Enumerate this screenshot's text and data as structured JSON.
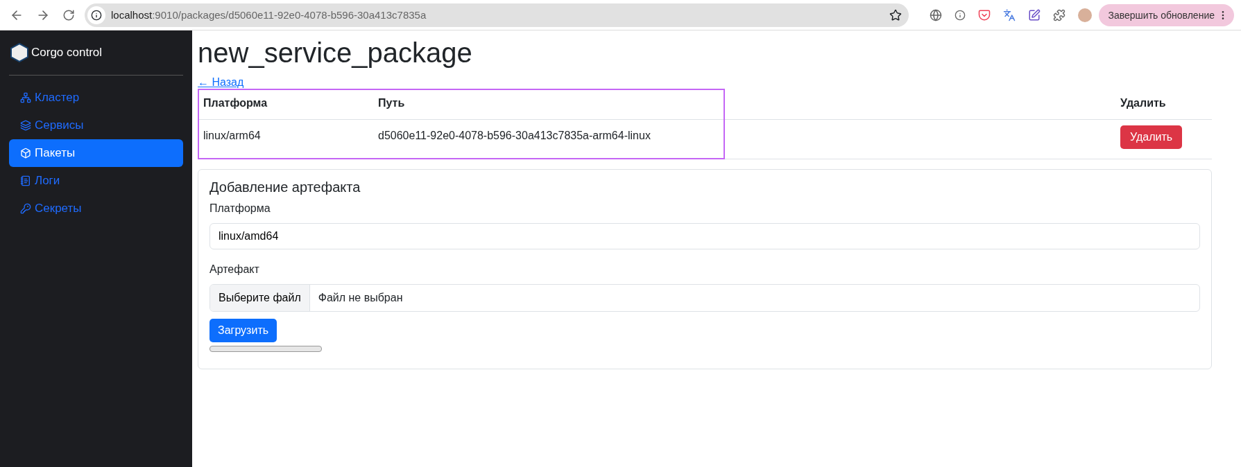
{
  "browser": {
    "url_host": "localhost",
    "url_path": ":9010/packages/d5060e11-92e0-4078-b596-30a413c7835a",
    "update_button": "Завершить обновление"
  },
  "sidebar": {
    "brand": "Corgo control",
    "items": [
      {
        "label": "Кластер",
        "selected": false
      },
      {
        "label": "Сервисы",
        "selected": false
      },
      {
        "label": "Пакеты",
        "selected": true
      },
      {
        "label": "Логи",
        "selected": false
      },
      {
        "label": "Секреты",
        "selected": false
      }
    ]
  },
  "page": {
    "title": "new_service_package",
    "back_link": "← Назад"
  },
  "table": {
    "columns": [
      "Платформа",
      "Путь",
      "Удалить"
    ],
    "rows": [
      {
        "platform": "linux/arm64",
        "path": "d5060e11-92e0-4078-b596-30a413c7835a-arm64-linux",
        "delete_button": "Удалить"
      }
    ]
  },
  "form": {
    "title": "Добавление артефакта",
    "platform_label": "Платформа",
    "platform_value": "linux/amd64",
    "artifact_label": "Артефакт",
    "file_button": "Выберите файл",
    "file_status": "Файл не выбран",
    "submit": "Загрузить",
    "progress": {
      "level": 0
    }
  }
}
